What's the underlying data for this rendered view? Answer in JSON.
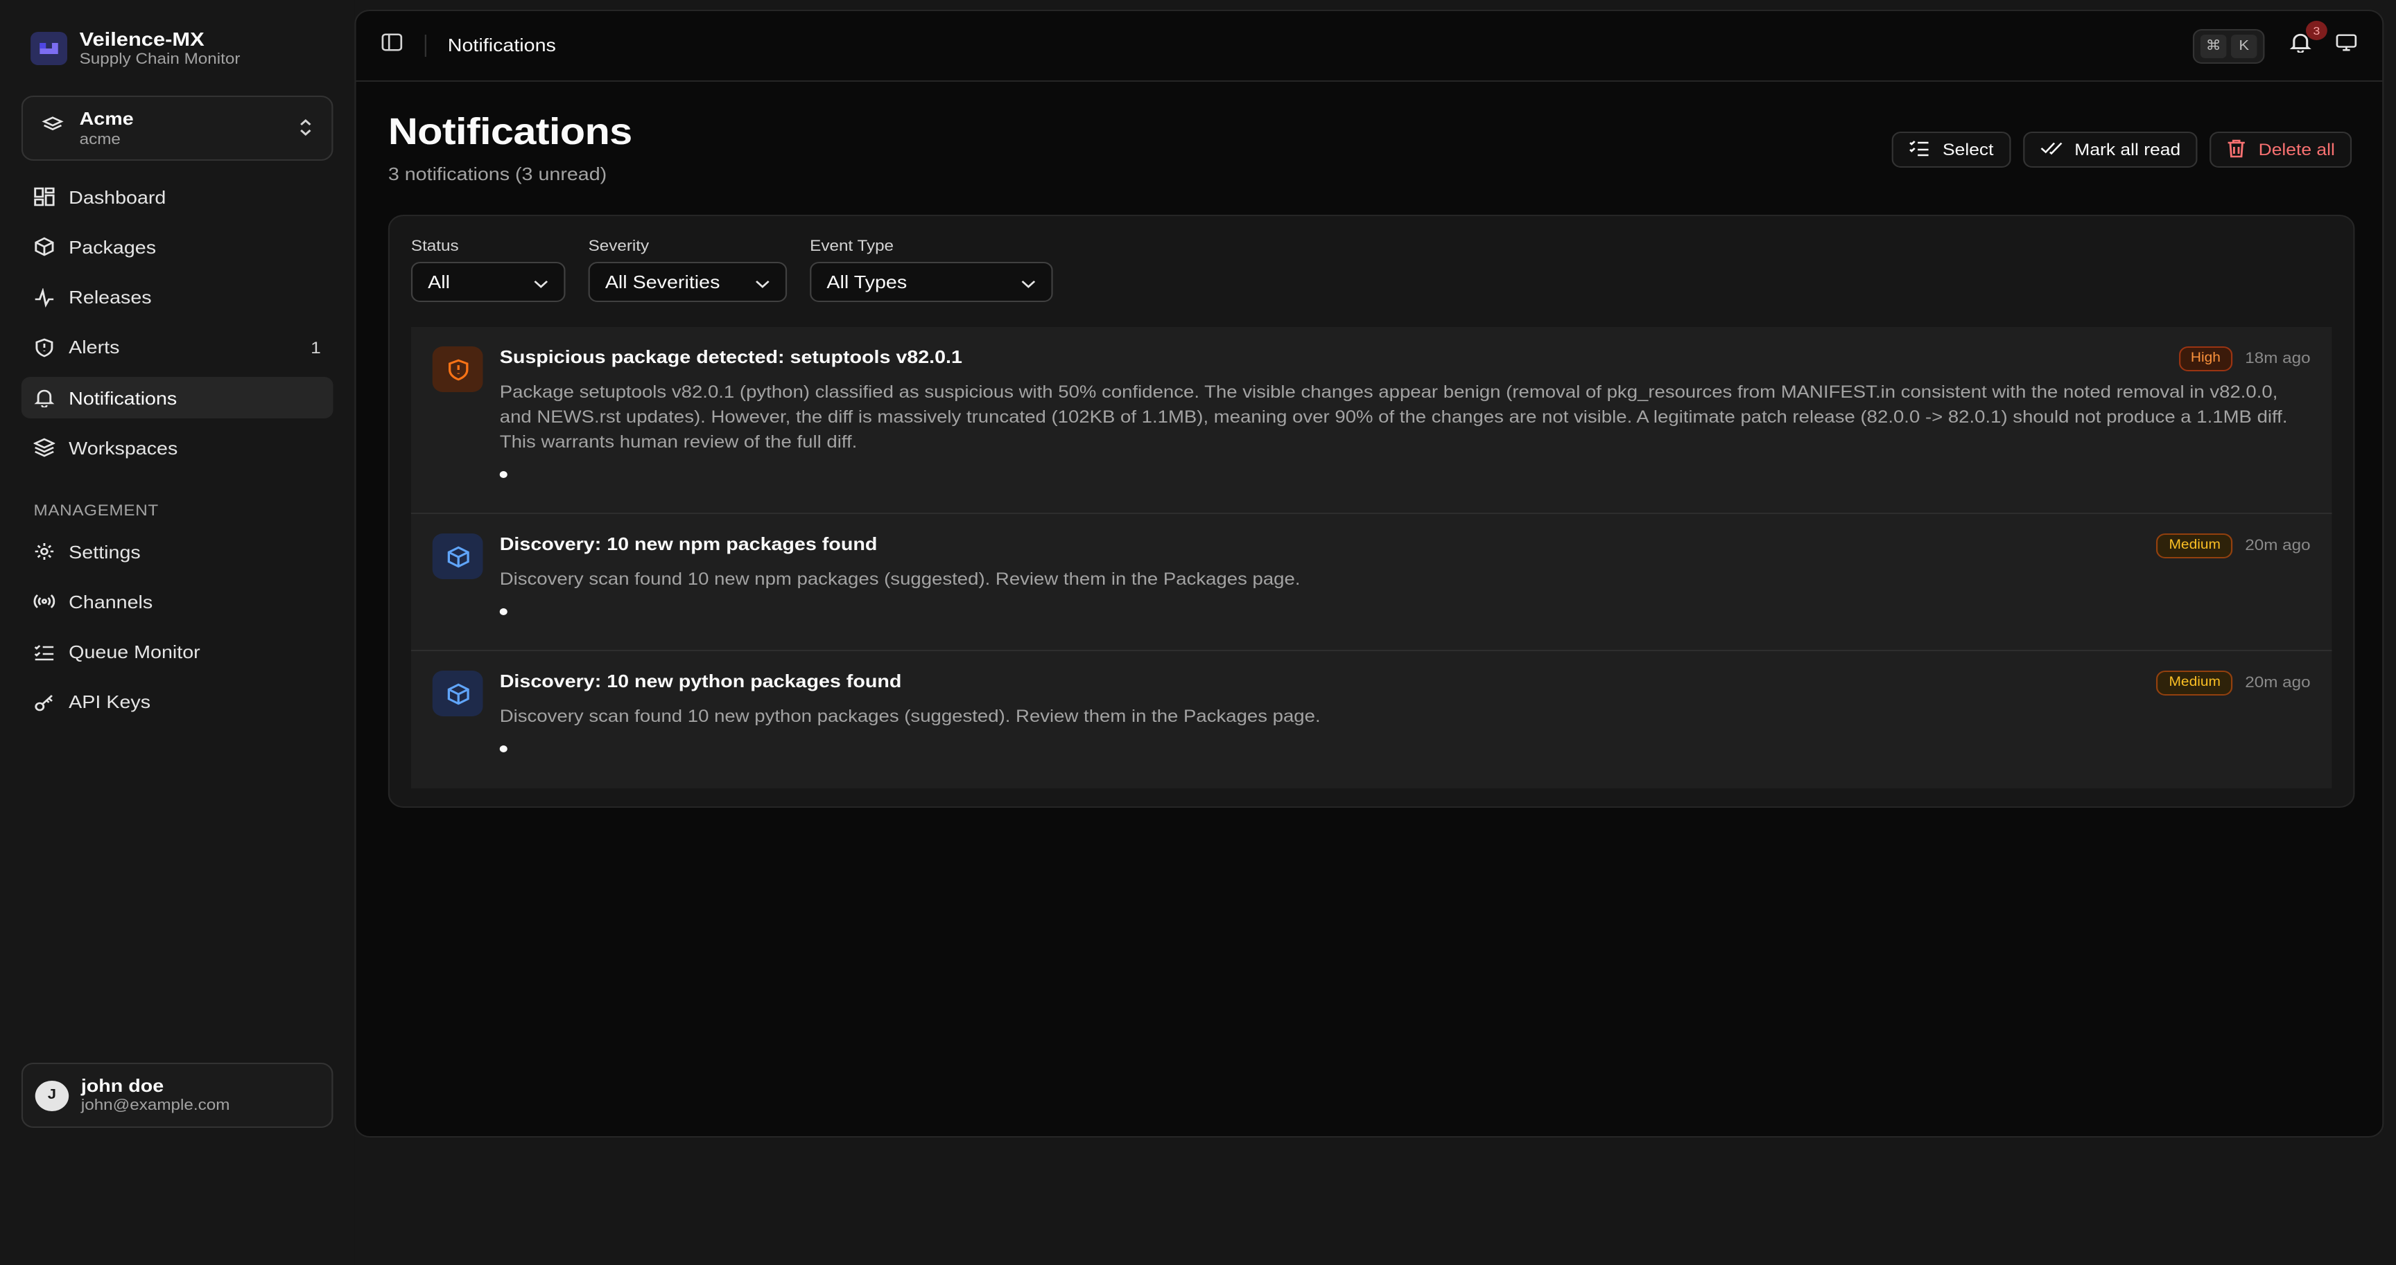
{
  "brand": {
    "name": "Veilence-MX",
    "subtitle": "Supply Chain Monitor"
  },
  "workspace": {
    "name": "Acme",
    "slug": "acme"
  },
  "nav": [
    {
      "label": "Dashboard",
      "icon": "dashboard-icon"
    },
    {
      "label": "Packages",
      "icon": "package-icon"
    },
    {
      "label": "Releases",
      "icon": "activity-icon"
    },
    {
      "label": "Alerts",
      "icon": "shield-icon",
      "count": "1"
    },
    {
      "label": "Notifications",
      "icon": "bell-icon",
      "active": true
    },
    {
      "label": "Workspaces",
      "icon": "layers-icon"
    }
  ],
  "management_label": "MANAGEMENT",
  "management": [
    {
      "label": "Settings",
      "icon": "gear-icon"
    },
    {
      "label": "Channels",
      "icon": "radio-icon"
    },
    {
      "label": "Queue Monitor",
      "icon": "list-icon"
    },
    {
      "label": "API Keys",
      "icon": "key-icon"
    }
  ],
  "user": {
    "initial": "J",
    "name": "john doe",
    "email": "john@example.com"
  },
  "topbar": {
    "breadcrumb": "Notifications",
    "kbd": [
      "⌘",
      "K"
    ],
    "bell_count": "3"
  },
  "page": {
    "title": "Notifications",
    "subtitle": "3 notifications (3 unread)"
  },
  "actions": {
    "select": "Select",
    "mark_all_read": "Mark all read",
    "delete_all": "Delete all"
  },
  "filters": {
    "status": {
      "label": "Status",
      "value": "All"
    },
    "severity": {
      "label": "Severity",
      "value": "All Severities"
    },
    "event_type": {
      "label": "Event Type",
      "value": "All Types"
    }
  },
  "notifications": [
    {
      "title": "Suspicious package detected: setuptools v82.0.1",
      "body": "Package setuptools v82.0.1 (python) classified as suspicious with 50% confidence. The visible changes appear benign (removal of pkg_resources from MANIFEST.in consistent with the noted removal in v82.0.0, and NEWS.rst updates). However, the diff is massively truncated (102KB of 1.1MB), meaning over 90% of the changes are not visible. A legitimate patch release (82.0.0 -> 82.0.1) should not produce a 1.1MB diff. This warrants human review of the full diff.",
      "severity": "High",
      "time": "18m ago",
      "icon": "shield-alert-icon",
      "unread": true
    },
    {
      "title": "Discovery: 10 new npm packages found",
      "body": "Discovery scan found 10 new npm packages (suggested). Review them in the Packages page.",
      "severity": "Medium",
      "time": "20m ago",
      "icon": "package-icon",
      "unread": true
    },
    {
      "title": "Discovery: 10 new python packages found",
      "body": "Discovery scan found 10 new python packages (suggested). Review them in the Packages page.",
      "severity": "Medium",
      "time": "20m ago",
      "icon": "package-icon",
      "unread": true
    }
  ],
  "colors": {
    "accent_high": "#fb923c",
    "accent_medium": "#fbbf24",
    "danger": "#f87171",
    "brand": "#6366f1"
  }
}
